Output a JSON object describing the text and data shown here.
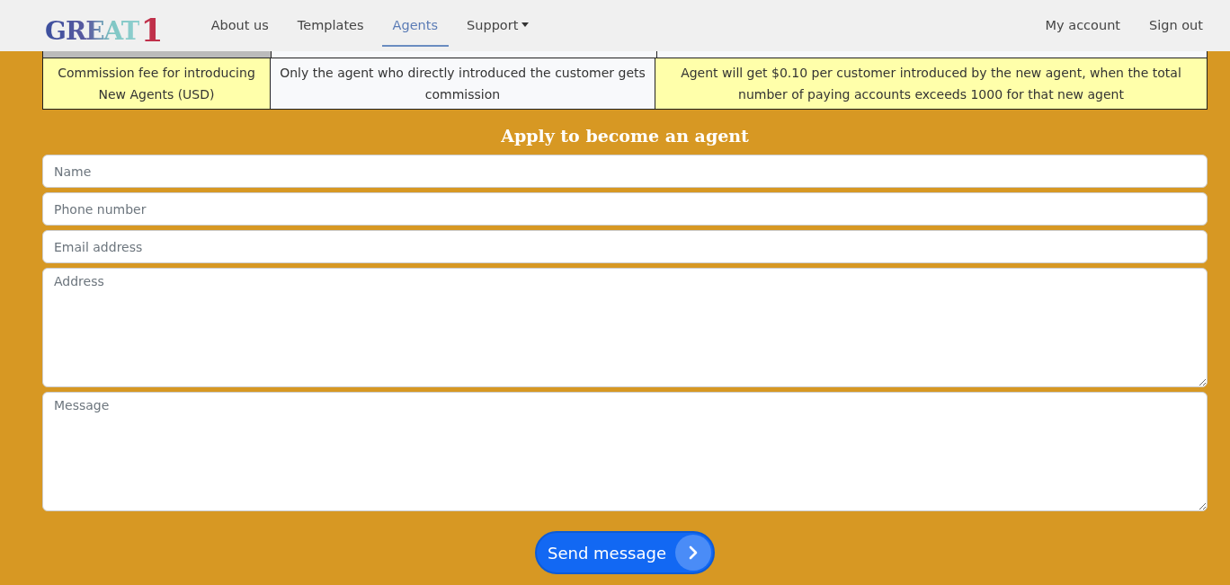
{
  "logo": {
    "letters": "GREAT",
    "mark": "1"
  },
  "nav": [
    {
      "label": "About us",
      "selected": false,
      "kind": "link"
    },
    {
      "label": "Templates",
      "selected": false,
      "kind": "link"
    },
    {
      "label": "Agents",
      "selected": true,
      "kind": "link"
    },
    {
      "label": "Support",
      "selected": false,
      "kind": "dropdown"
    }
  ],
  "account_nav": [
    "My account",
    "Sign out"
  ],
  "table": {
    "rows": [
      {
        "cells": [
          "Commission fee for introducing New Agents (USD)",
          "Only the agent who directly introduced the customer gets commission",
          "Agent will get $0.10 per customer introduced by the new agent, when the total number of paying accounts exceeds 1000 for that new agent"
        ]
      }
    ]
  },
  "form": {
    "title": "Apply to become an agent",
    "fields": [
      {
        "placeholder": "Name",
        "kind": "input"
      },
      {
        "placeholder": "Phone number",
        "kind": "input"
      },
      {
        "placeholder": "Email address",
        "kind": "input"
      },
      {
        "placeholder": "Address",
        "kind": "textarea"
      },
      {
        "placeholder": "Message",
        "kind": "textarea"
      }
    ],
    "submit": "Send message"
  }
}
